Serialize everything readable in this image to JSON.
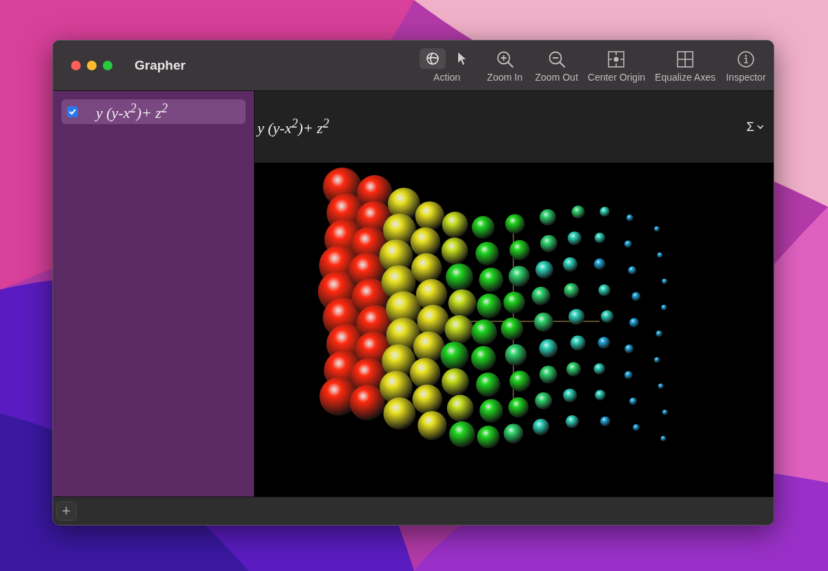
{
  "window": {
    "title": "Grapher"
  },
  "toolbar": [
    {
      "kind": "mode",
      "label": "Action",
      "modes": [
        {
          "kind": "globe",
          "selected": true
        },
        {
          "kind": "pointer",
          "selected": false
        }
      ]
    },
    {
      "kind": "zoom-in",
      "label": "Zoom In"
    },
    {
      "kind": "zoom-out",
      "label": "Zoom Out"
    },
    {
      "kind": "center",
      "label": "Center Origin"
    },
    {
      "kind": "equalize",
      "label": "Equalize Axes"
    },
    {
      "kind": "inspector",
      "label": "Inspector"
    }
  ],
  "sidebar": {
    "equations": [
      {
        "text": "y (y-x$^{2}$)+ z$^{2}$",
        "checked": true,
        "selected": true
      }
    ],
    "add_button": "+"
  },
  "graph": {
    "equation": "y (y-x$^{2}$)+ z$^{2}$",
    "sum_button": "Σ"
  }
}
